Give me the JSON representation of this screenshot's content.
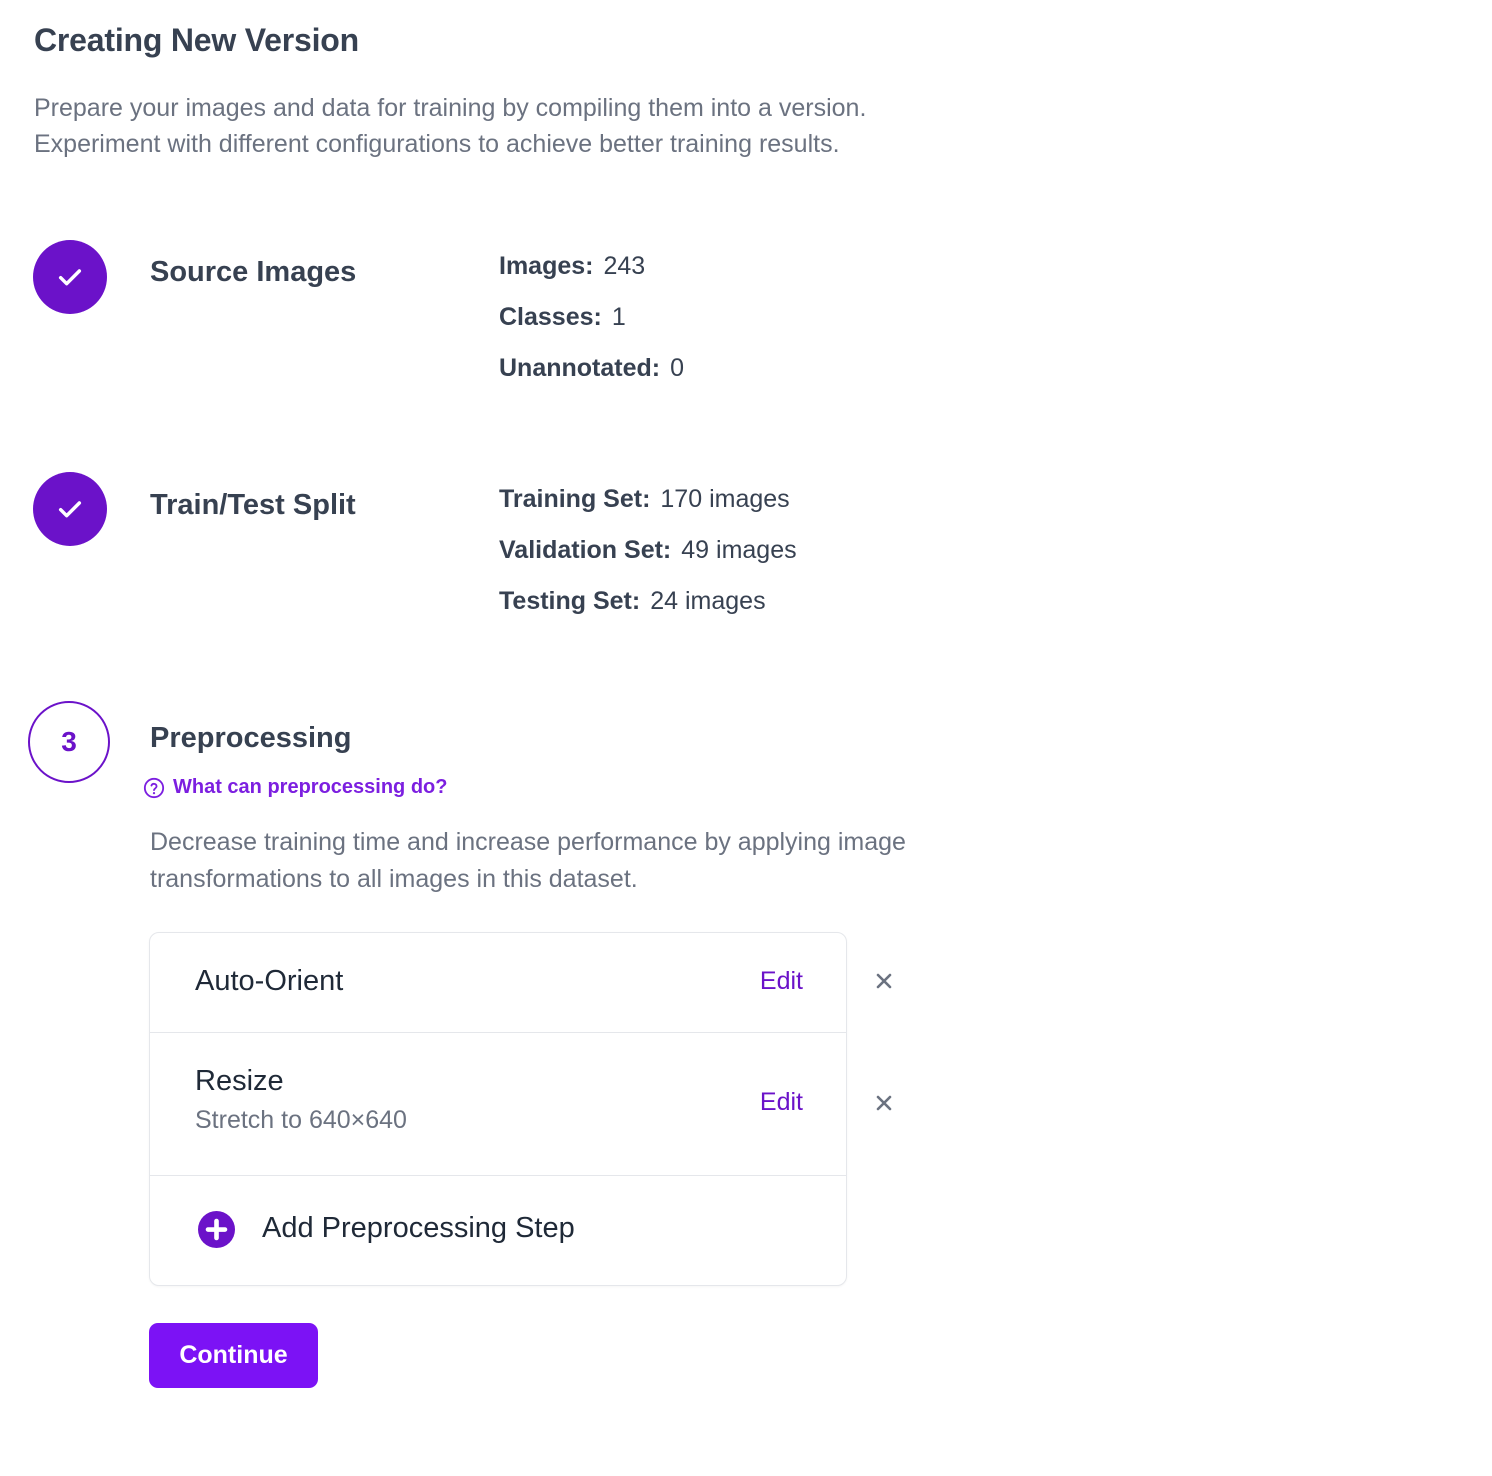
{
  "page": {
    "title": "Creating New Version",
    "intro_line1": "Prepare your images and data for training by compiling them into a version.",
    "intro_line2": "Experiment with different configurations to achieve better training results."
  },
  "steps": {
    "source": {
      "title": "Source Images",
      "status": "complete",
      "stats": [
        {
          "label": "Images:",
          "value": "243"
        },
        {
          "label": "Classes:",
          "value": "1"
        },
        {
          "label": "Unannotated:",
          "value": "0"
        }
      ]
    },
    "split": {
      "title": "Train/Test Split",
      "status": "complete",
      "stats": [
        {
          "label": "Training Set:",
          "value": "170 images"
        },
        {
          "label": "Validation Set:",
          "value": "49 images"
        },
        {
          "label": "Testing Set:",
          "value": "24 images"
        }
      ]
    },
    "preprocessing": {
      "number": "3",
      "status": "current",
      "title": "Preprocessing",
      "help_link": "What can preprocessing do?",
      "description_line1": "Decrease training time and increase performance by applying image",
      "description_line2": "transformations to all images in this dataset.",
      "items": [
        {
          "title": "Auto-Orient",
          "subtitle": "",
          "edit_label": "Edit"
        },
        {
          "title": "Resize",
          "subtitle": "Stretch to 640×640",
          "edit_label": "Edit"
        }
      ],
      "add_label": "Add Preprocessing Step",
      "continue_label": "Continue"
    }
  },
  "colors": {
    "accent": "#6b12c9",
    "button": "#7c12f5",
    "text": "#374151",
    "muted": "#6b7280",
    "border": "#e5e7eb"
  },
  "icons": {
    "step_done": "check-icon",
    "help": "question-circle-icon",
    "remove": "close-icon",
    "add": "plus-circle-icon"
  }
}
